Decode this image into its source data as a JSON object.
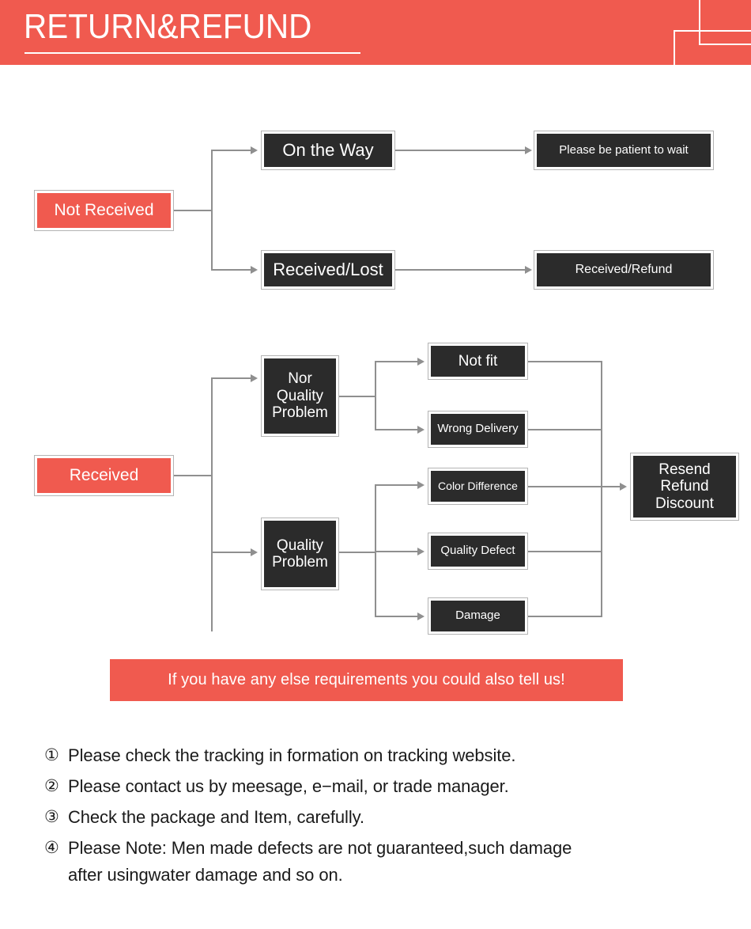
{
  "header": {
    "title": "RETURN&REFUND",
    "background_color": "#f05a4f",
    "text_color": "#ffffff"
  },
  "colors": {
    "accent_red": "#f05a4f",
    "node_dark": "#2b2b2b",
    "node_border": "#b4b4b4",
    "connector": "#8f8f8f",
    "page_background": "#ffffff"
  },
  "flowchart_not_received": {
    "root": {
      "label": "Not Received",
      "style": "red"
    },
    "branches": [
      {
        "label": "On the Way",
        "style": "dark",
        "outcome": {
          "label": "Please be patient to wait",
          "style": "dark"
        }
      },
      {
        "label": "Received/Lost",
        "style": "dark",
        "outcome": {
          "label": "Received/Refund",
          "style": "dark"
        }
      }
    ]
  },
  "flowchart_received": {
    "root": {
      "label": "Received",
      "style": "red"
    },
    "branches": [
      {
        "label": "Nor\nQuality\nProblem",
        "style": "dark",
        "reasons": [
          {
            "label": "Not fit"
          },
          {
            "label": "Wrong Delivery"
          }
        ]
      },
      {
        "label": "Quality\nProblem",
        "style": "dark",
        "reasons": [
          {
            "label": "Color Difference"
          },
          {
            "label": "Quality Defect"
          },
          {
            "label": "Damage"
          }
        ]
      }
    ],
    "outcome": {
      "label": "Resend\nRefund\nDiscount",
      "style": "dark"
    }
  },
  "callout": {
    "text": "If you have any else requirements you could also tell us!"
  },
  "notes": [
    {
      "num": "①",
      "text": "Please check the tracking in formation on tracking website."
    },
    {
      "num": "②",
      "text": "Please contact us by meesage, e−mail, or trade manager."
    },
    {
      "num": "③",
      "text": "Check the package and Item, carefully."
    },
    {
      "num": "④",
      "text": "Please Note: Men made defects are not guaranteed,such damage\nafter usingwater damage and so on."
    }
  ]
}
